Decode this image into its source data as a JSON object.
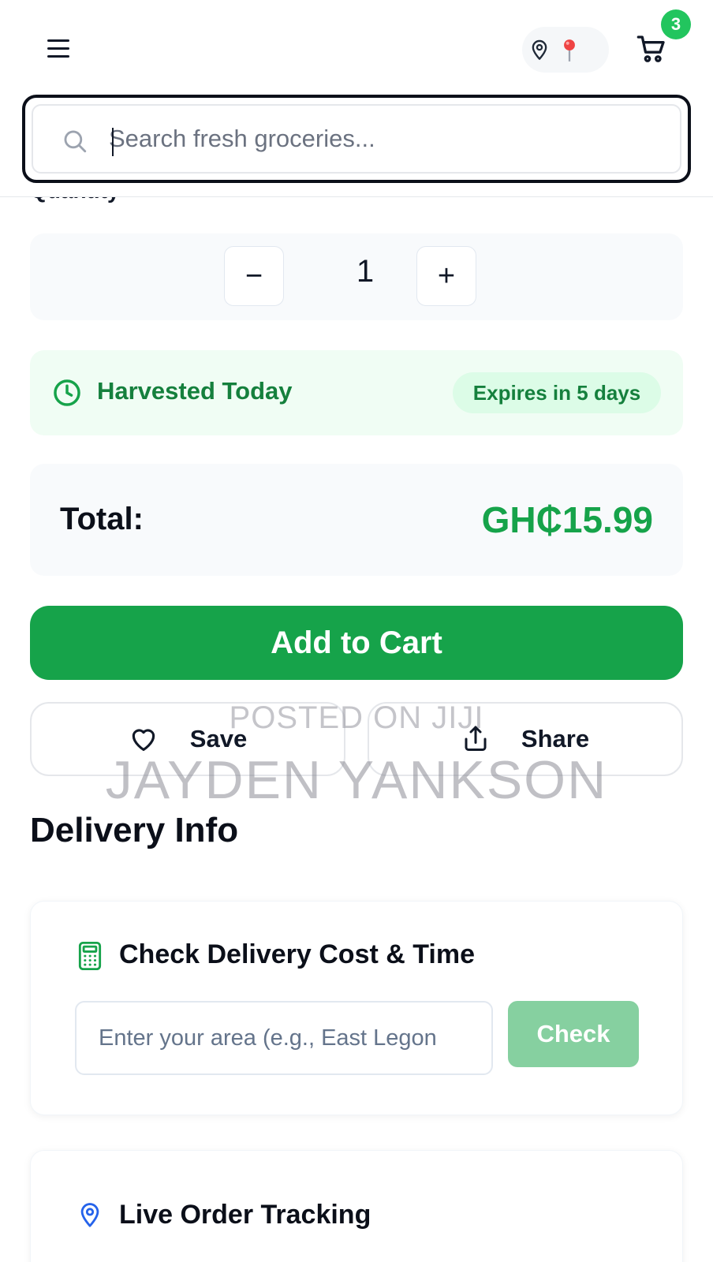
{
  "header": {
    "menu_icon": "hamburger-menu-icon",
    "location_icons": [
      "map-pin-outline-icon",
      "red-pin-emoji"
    ],
    "cart_icon": "shopping-cart-icon",
    "cart_count": "3"
  },
  "search": {
    "placeholder": "Search fresh groceries...",
    "value": ""
  },
  "quantity": {
    "label": "Quantity",
    "minus": "−",
    "value": "1",
    "plus": "+"
  },
  "freshness": {
    "label": "Harvested Today",
    "expires": "Expires in 5 days"
  },
  "total": {
    "label": "Total:",
    "value": "GH₵15.99"
  },
  "actions": {
    "add_to_cart": "Add to Cart",
    "save": "Save",
    "share": "Share"
  },
  "watermark": {
    "line1": "POSTED ON JIJI",
    "line2": "JAYDEN YANKSON"
  },
  "delivery": {
    "title": "Delivery Info",
    "cost_card": {
      "title": "Check Delivery Cost & Time",
      "input_placeholder": "Enter your area (e.g., East Legon",
      "check_button": "Check"
    },
    "tracking_card": {
      "title": "Live Order Tracking"
    }
  },
  "colors": {
    "accent_green": "#16a34a",
    "badge_green": "#22c55e",
    "fresh_bg": "#f0fdf4",
    "check_disabled": "#86d0a0",
    "tracking_icon_blue": "#2563eb"
  }
}
